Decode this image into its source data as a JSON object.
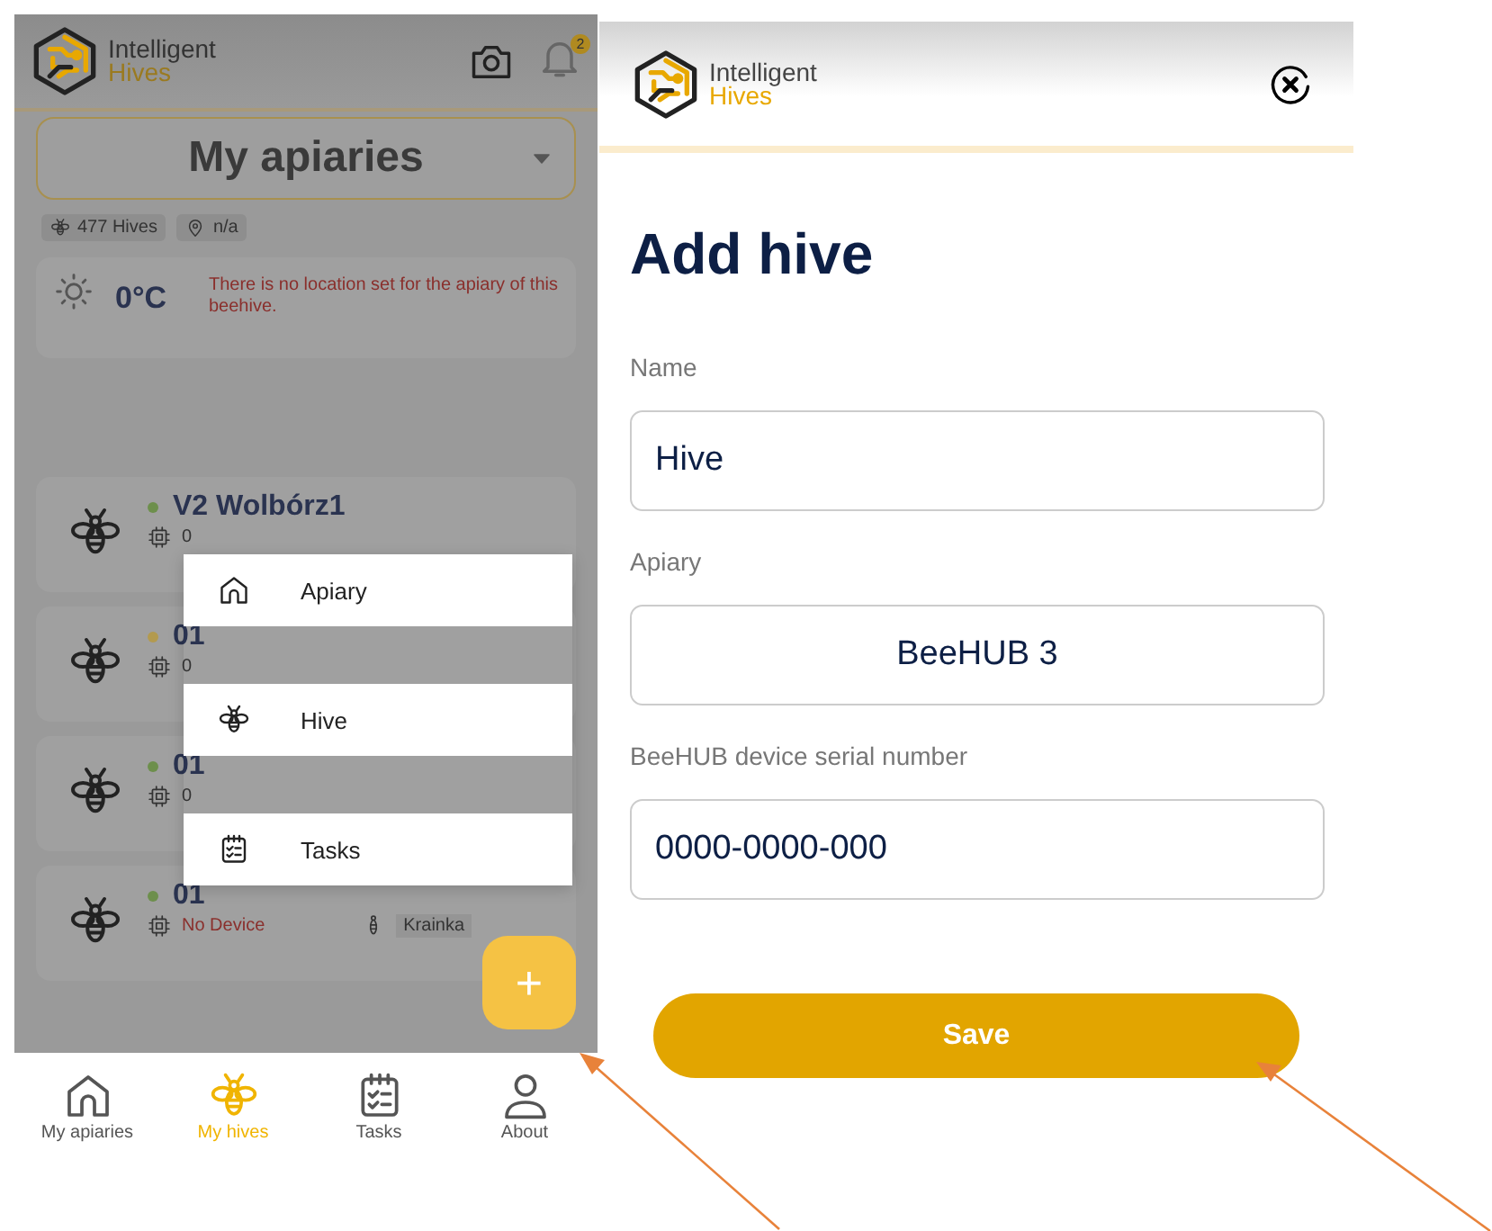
{
  "left_screen": {
    "header": {
      "logo_line1": "Intelligent",
      "logo_line2": "Hives",
      "notification_count": "2"
    },
    "apiary_selector": {
      "value": "My apiaries"
    },
    "chips": [
      {
        "kind": "hives",
        "label": "477 Hives"
      },
      {
        "kind": "location",
        "label": "n/a"
      }
    ],
    "weather": {
      "temperature": "0°C",
      "message": "There is no location set for the apiary of this beehive."
    },
    "hives": [
      {
        "name": "V2 Wolbórz1",
        "color": "#6d8f4c",
        "device": "0",
        "device_missing": false
      },
      {
        "name": "01",
        "color": "#b39a4f",
        "device": "0",
        "device_missing": false
      },
      {
        "name": "01",
        "color": "#6d8f4c",
        "device": "0",
        "device_missing": false
      },
      {
        "name": "01",
        "color": "#6d8f4c",
        "device": "No Device",
        "device_missing": true,
        "queen": "Krainka"
      }
    ],
    "add_menu": [
      {
        "kind": "apiary",
        "label": "Apiary"
      },
      {
        "kind": "hive",
        "label": "Hive"
      },
      {
        "kind": "tasks",
        "label": "Tasks"
      }
    ],
    "fab": {
      "label": "+"
    },
    "nav": [
      {
        "kind": "apiaries",
        "label": "My apiaries",
        "selected": false
      },
      {
        "kind": "hives",
        "label": "My hives",
        "selected": true
      },
      {
        "kind": "tasks",
        "label": "Tasks",
        "selected": false
      },
      {
        "kind": "about",
        "label": "About",
        "selected": false
      }
    ]
  },
  "right_screen": {
    "header": {
      "logo_line1": "Intelligent",
      "logo_line2": "Hives"
    },
    "title": "Add hive",
    "fields": [
      {
        "kind": "text",
        "label": "Name",
        "value": "Hive"
      },
      {
        "kind": "select",
        "label": "Apiary",
        "value": "BeeHUB 3"
      },
      {
        "kind": "text",
        "label": "BeeHUB device serial number",
        "value": "0000-0000-000"
      }
    ],
    "save_button": "Save"
  }
}
